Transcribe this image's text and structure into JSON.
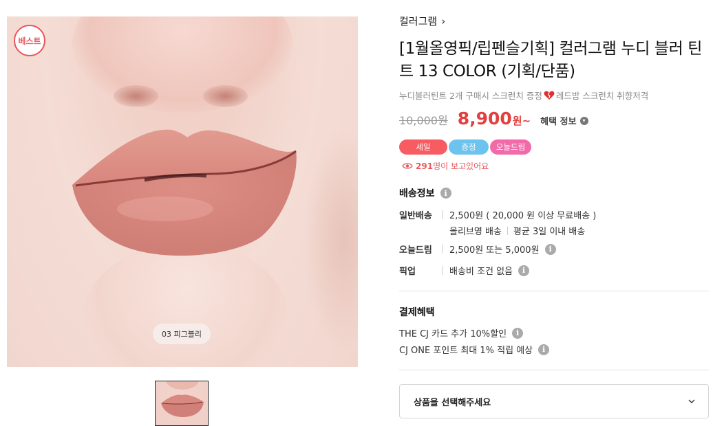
{
  "gallery": {
    "badge": "베스트",
    "color_chip": "03 피그블리"
  },
  "product": {
    "brand": "컬러그램",
    "brand_arrow": "›",
    "title": "[1월올영픽/립펜슬기획] 컬러그램 누디 블러 틴트 13 COLOR (기획/단품)",
    "promo_before": "누디블러틴트 2개 구매시 스크런치 증정",
    "promo_after": "레드밤 스크런치 취향저격",
    "original_price": "10,000원",
    "sale_price": "8,900",
    "sale_suffix": "원~",
    "benefit_label": "혜택 정보",
    "flags": [
      "세일",
      "증정",
      "오늘드림"
    ],
    "viewers_count": "291",
    "viewers_text": "명이 보고있어요"
  },
  "shipping": {
    "title": "배송정보",
    "rows": [
      {
        "label": "일반배송",
        "lines": [
          "2,500원 ( 20,000 원 이상 무료배송 )"
        ],
        "sub": [
          "올리브영 배송",
          "평균 3일 이내 배송"
        ]
      },
      {
        "label": "오늘드림",
        "lines": [
          "2,500원 또는 5,000원"
        ]
      },
      {
        "label": "픽업",
        "lines": [
          "배송비 조건 없음"
        ]
      }
    ]
  },
  "payment": {
    "title": "결제혜택",
    "lines": [
      "THE CJ 카드 추가 10%할인",
      "CJ ONE 포인트 최대 1% 적립 예상"
    ]
  },
  "option_select": {
    "placeholder": "상품을 선택해주세요"
  },
  "colors": {
    "accent_red": "#e33f3f",
    "flag_sale": "#f65c62",
    "flag_gift": "#6cc3ee",
    "flag_today": "#f26aaa"
  }
}
